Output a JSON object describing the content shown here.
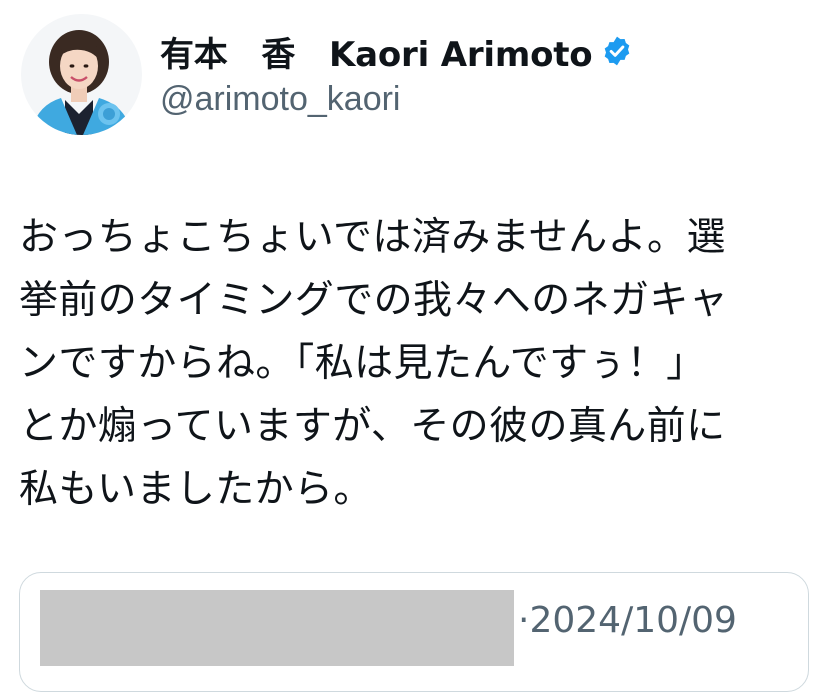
{
  "author": {
    "display_name": "有本　香　Kaori Arimoto",
    "handle": "@arimoto_kaori",
    "verified_icon": "verified-badge-icon",
    "verified_color": "#1d9bf0"
  },
  "tweet": {
    "text_lines": [
      "おっちょこちょいでは済みませんよ。選",
      "挙前のタイミングでの我々へのネガキャ",
      "ンですからね。「私は見たんですぅ！」",
      "とか煽っていますが、その彼の真ん前に",
      "私もいましたから。"
    ]
  },
  "quoted_tweet": {
    "separator": "·",
    "date": "2024/10/09"
  },
  "colors": {
    "text_primary": "#0f1419",
    "text_secondary": "#536471",
    "card_border": "#cfd9de",
    "redaction": "#c7c7c7",
    "avatar_jacket": "#3fa9e0"
  }
}
